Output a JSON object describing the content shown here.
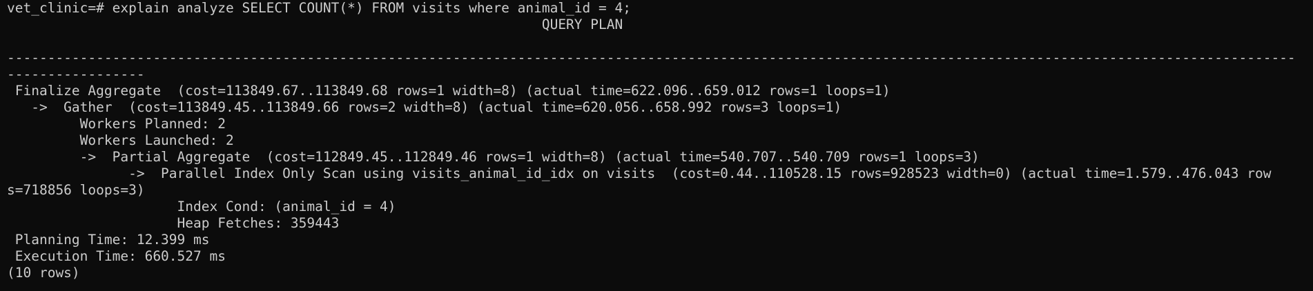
{
  "terminal": {
    "lines": [
      "vet_clinic=# explain analyze SELECT COUNT(*) FROM visits where animal_id = 4;",
      "                                                                  QUERY PLAN",
      "",
      "---------------------------------------------------------------------------------------------------------------------------------------------------------------",
      "-----------------",
      " Finalize Aggregate  (cost=113849.67..113849.68 rows=1 width=8) (actual time=622.096..659.012 rows=1 loops=1)",
      "   ->  Gather  (cost=113849.45..113849.66 rows=2 width=8) (actual time=620.056..658.992 rows=3 loops=1)",
      "         Workers Planned: 2",
      "         Workers Launched: 2",
      "         ->  Partial Aggregate  (cost=112849.45..112849.46 rows=1 width=8) (actual time=540.707..540.709 rows=1 loops=3)",
      "               ->  Parallel Index Only Scan using visits_animal_id_idx on visits  (cost=0.44..110528.15 rows=928523 width=0) (actual time=1.579..476.043 row",
      "s=718856 loops=3)",
      "                     Index Cond: (animal_id = 4)",
      "                     Heap Fetches: 359443",
      " Planning Time: 12.399 ms",
      " Execution Time: 660.527 ms",
      "(10 rows)"
    ]
  }
}
